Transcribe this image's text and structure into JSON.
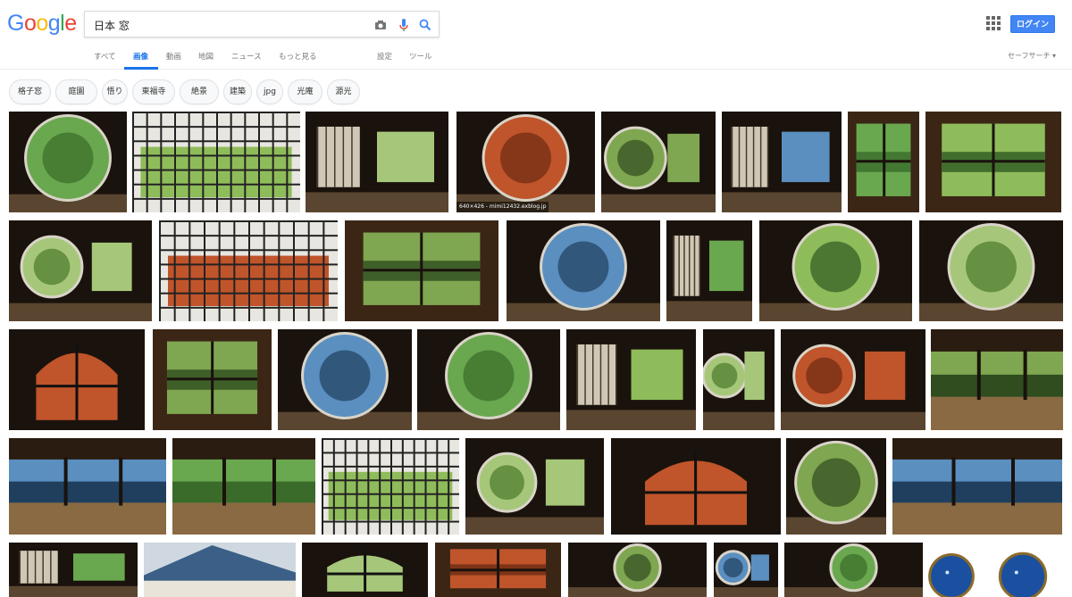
{
  "logo": {
    "letters": [
      "G",
      "o",
      "o",
      "g",
      "l",
      "e"
    ],
    "colors": [
      "#4285f4",
      "#ea4335",
      "#fbbc05",
      "#4285f4",
      "#34a853",
      "#ea4335"
    ]
  },
  "search": {
    "value": "日本 窓",
    "placeholder": ""
  },
  "header": {
    "login_label": "ログイン"
  },
  "nav_tabs": [
    {
      "label": "すべて",
      "active": false
    },
    {
      "label": "画像",
      "active": true
    },
    {
      "label": "動画",
      "active": false
    },
    {
      "label": "地図",
      "active": false
    },
    {
      "label": "ニュース",
      "active": false
    },
    {
      "label": "もっと見る",
      "active": false
    },
    {
      "label": "設定",
      "active": false
    },
    {
      "label": "ツール",
      "active": false
    }
  ],
  "safesearch_label": "セーフサーチ ▾",
  "chips": [
    "格子窓",
    "庭園",
    "悟り",
    "東福寺",
    "絶景",
    "建築",
    "jpg",
    "光庵",
    "源光"
  ],
  "hover_caption": "640×426 - mimi12432.exblog.jp",
  "colors": {
    "accent": "#1a73e8",
    "login_bg": "#4285f4"
  },
  "images": [
    {
      "style": "round",
      "cap": false
    },
    {
      "style": "lattice",
      "cap": false
    },
    {
      "style": "shoji",
      "cap": false
    },
    {
      "style": "round",
      "cap": true
    },
    {
      "style": "round-small",
      "cap": false
    },
    {
      "style": "shoji",
      "cap": false
    },
    {
      "style": "window",
      "cap": false
    },
    {
      "style": "window",
      "cap": false
    },
    {
      "style": "round-small",
      "cap": false
    },
    {
      "style": "lattice",
      "cap": false
    },
    {
      "style": "window",
      "cap": false
    },
    {
      "style": "round",
      "cap": false
    },
    {
      "style": "shoji",
      "cap": false
    },
    {
      "style": "round",
      "cap": false
    },
    {
      "style": "round",
      "cap": false
    },
    {
      "style": "arch",
      "cap": false
    },
    {
      "style": "window",
      "cap": false
    },
    {
      "style": "round",
      "cap": false
    },
    {
      "style": "round",
      "cap": false
    },
    {
      "style": "shoji",
      "cap": false
    },
    {
      "style": "round-small",
      "cap": false
    },
    {
      "style": "round-small",
      "cap": false
    },
    {
      "style": "room",
      "cap": false
    },
    {
      "style": "room",
      "cap": false
    },
    {
      "style": "room",
      "cap": false
    },
    {
      "style": "lattice",
      "cap": false
    },
    {
      "style": "round-small",
      "cap": false
    },
    {
      "style": "arch",
      "cap": false
    },
    {
      "style": "round",
      "cap": false
    },
    {
      "style": "room",
      "cap": false
    },
    {
      "style": "shoji",
      "cap": false
    },
    {
      "style": "roof",
      "cap": false
    },
    {
      "style": "arch",
      "cap": false
    },
    {
      "style": "window",
      "cap": false
    },
    {
      "style": "round",
      "cap": false
    },
    {
      "style": "round-small",
      "cap": false
    },
    {
      "style": "round",
      "cap": false
    },
    {
      "style": "pendant",
      "cap": false
    },
    {
      "style": "pendant",
      "cap": false
    }
  ]
}
